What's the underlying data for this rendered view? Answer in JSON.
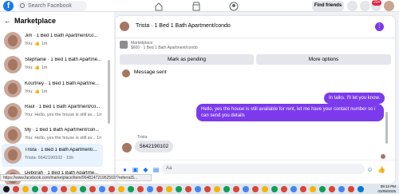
{
  "topbar": {
    "logo": "f",
    "search_placeholder": "Search Facebook",
    "find_friends": "Find friends",
    "notif_badge": "20+"
  },
  "sidebar": {
    "title": "Marketplace",
    "back": "←",
    "items": [
      {
        "title": "Jim · 1 Bed 1 Bath Apartment/co...",
        "sub": "You: 👍 1m"
      },
      {
        "title": "Stephanie · 1 Bed 1 Bath Apartme...",
        "sub": "You: 👍 1m"
      },
      {
        "title": "Kourtney · 1 Bed 1 Bath Apartme...",
        "sub": "You: 👍 1m"
      },
      {
        "title": "Raúl · 1 Bed 1 Bath Apartment/co...",
        "sub": "You: Hello, yes the house is still av...  1m"
      },
      {
        "title": "Mý · 1 Bed 1 Bath Apartment/con...",
        "sub": "You: Hello, yes the house is still av...  1m"
      },
      {
        "title": "Trista · 1 Bed 1 Bath Apartment/...",
        "sub": "Trista: 5642190102 · 15h"
      },
      {
        "title": "Deborah · 1 Bed 1 Bath Apartme...",
        "sub": ""
      }
    ]
  },
  "chat": {
    "header_title": "Trista · 1 Bed 1 Bath Apartment/condo",
    "listing_label": "Marketplace",
    "listing_price": "$600 · 1 Bed 1 Bath Apartment/condo",
    "mark_pending": "Mark as pending",
    "more_options": "More options",
    "system_message": "Message sent",
    "out_message_1": "In talks. I'll let you know.",
    "out_message_2": "Hello, yes the house is still available for rent, let me have your contact number so i can send you details",
    "in_name": "Trista",
    "in_message": "5642190102",
    "composer_placeholder": "Aa"
  },
  "statusbar": {
    "url": "https://www.facebook.com/marketplace/item/964814721952502/?referralS..."
  },
  "taskbar": {
    "time": "09:12 PM",
    "date": "03/09/2025"
  },
  "colors": {
    "accent": "#7c3aed",
    "facebook_blue": "#1877f2"
  }
}
